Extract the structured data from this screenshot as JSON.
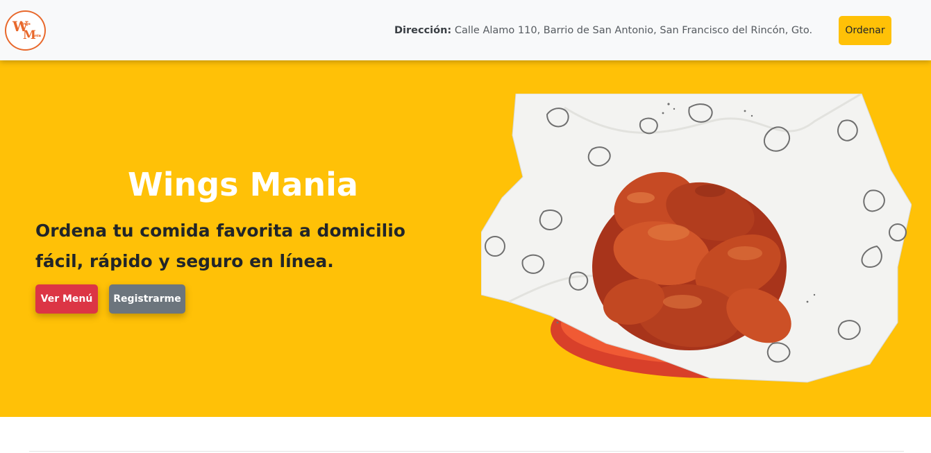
{
  "navbar": {
    "logo": {
      "big_letters": [
        "W",
        "M"
      ],
      "small_letters": [
        "ings",
        "ania"
      ],
      "color": "#e8682b"
    },
    "address_label": "Dirección:",
    "address_value": "Calle Alamo 110, Barrio de San Antonio, San Francisco del Rincón, Gto.",
    "order_button": "Ordenar"
  },
  "hero": {
    "title": "Wings Mania",
    "subtitle": "Ordena tu comida favorita a domicilio fácil, rápido y seguro en línea.",
    "menu_button": "Ver Menú",
    "register_button": "Registrarme",
    "background_color": "#ffc107",
    "image": "chicken-wings-basket"
  },
  "colors": {
    "accent": "#ffc107",
    "danger": "#dc3545",
    "secondary": "#6c757d"
  }
}
